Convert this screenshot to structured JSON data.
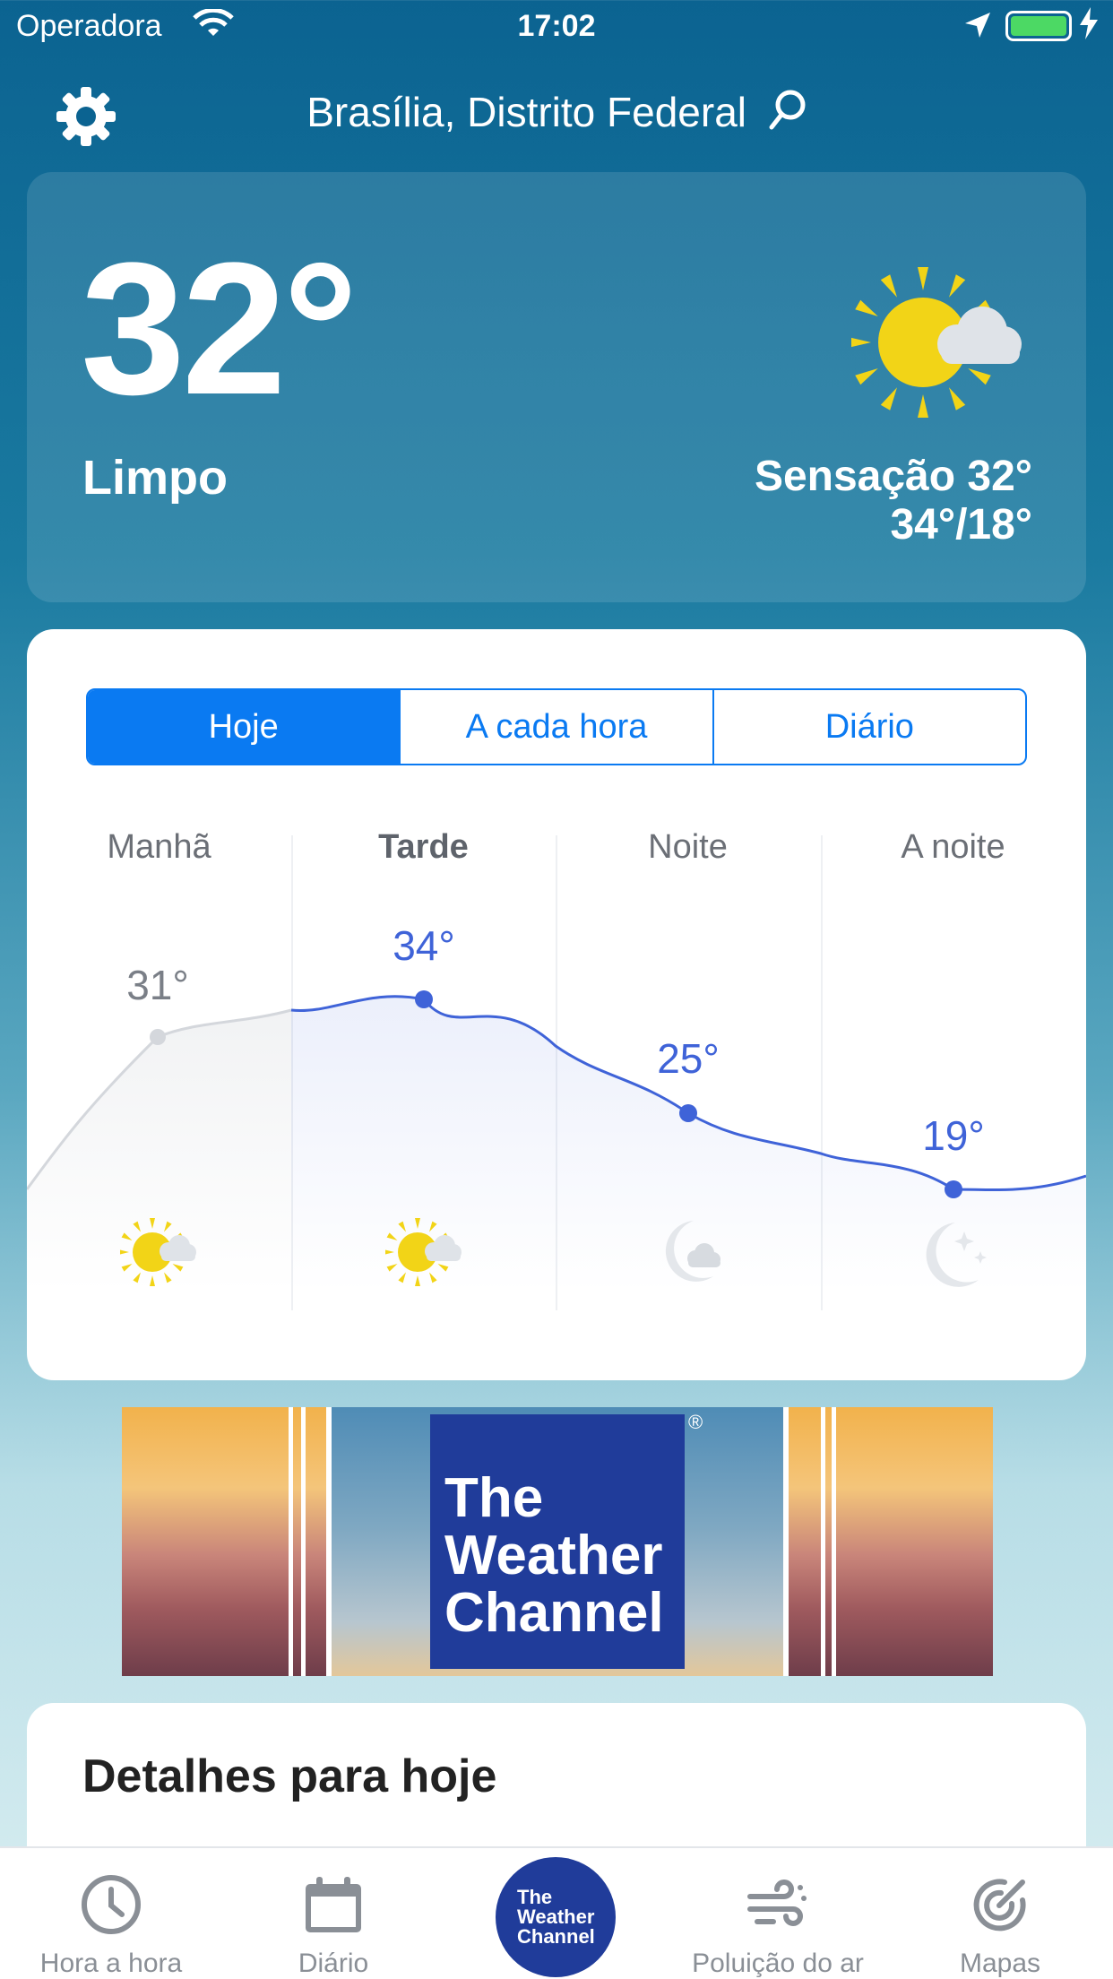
{
  "status_bar": {
    "carrier": "Operadora",
    "time": "17:02"
  },
  "header": {
    "location": "Brasília, Distrito Federal"
  },
  "current": {
    "temperature": "32°",
    "condition": "Limpo",
    "feels_like": "Sensação 32°",
    "hi_lo": "34°/18°",
    "icon": "sun-cloud-icon"
  },
  "forecast": {
    "tabs": [
      {
        "label": "Hoje",
        "active": true
      },
      {
        "label": "A cada hora",
        "active": false
      },
      {
        "label": "Diário",
        "active": false
      }
    ],
    "periods": [
      {
        "label": "Manhã",
        "temp": "31°",
        "icon": "sun-cloud-icon"
      },
      {
        "label": "Tarde",
        "temp": "34°",
        "icon": "sun-cloud-icon"
      },
      {
        "label": "Noite",
        "temp": "25°",
        "icon": "moon-cloud-icon"
      },
      {
        "label": "A noite",
        "temp": "19°",
        "icon": "moon-stars-icon"
      }
    ],
    "accent_color": "#3f63d8"
  },
  "ad": {
    "brand_line1": "The",
    "brand_line2": "Weather",
    "brand_line3": "Channel",
    "reg": "®"
  },
  "details": {
    "title": "Detalhes para hoje"
  },
  "bottom_nav": {
    "items": [
      {
        "label": "Hora a hora",
        "icon": "clock-icon"
      },
      {
        "label": "Diário",
        "icon": "calendar-icon"
      },
      {
        "label": "",
        "icon": "weather-channel-logo"
      },
      {
        "label": "Poluição do ar",
        "icon": "wind-icon"
      },
      {
        "label": "Mapas",
        "icon": "radar-icon"
      }
    ],
    "logo_line1": "The",
    "logo_line2": "Weather",
    "logo_line3": "Channel"
  }
}
